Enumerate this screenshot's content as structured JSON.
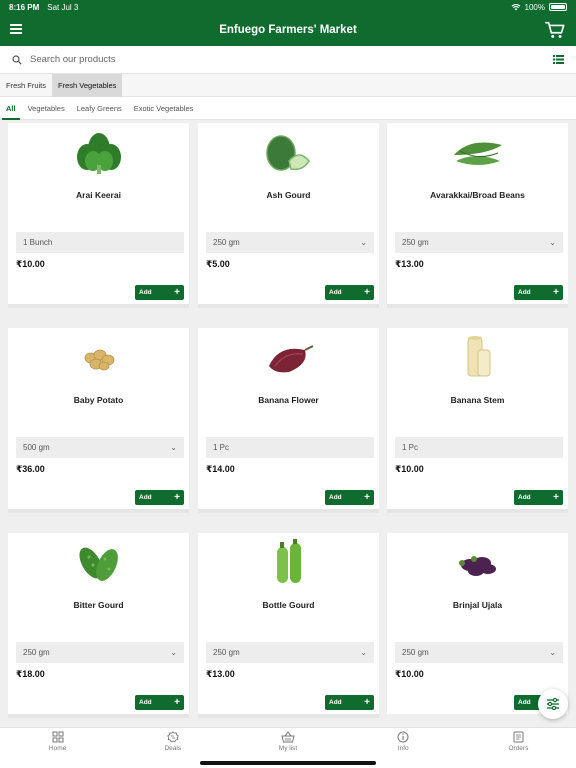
{
  "status_bar": {
    "time": "8:16 PM",
    "date": "Sat Jul 3",
    "battery": "100%"
  },
  "header": {
    "title": "Enfuego Farmers' Market"
  },
  "search": {
    "placeholder": "Search our products"
  },
  "category_tabs": [
    {
      "label": "Fresh Fruits",
      "active": false
    },
    {
      "label": "Fresh Vegetables",
      "active": true
    }
  ],
  "sub_tabs": [
    {
      "label": "All",
      "active": true
    },
    {
      "label": "Vegetables",
      "active": false
    },
    {
      "label": "Leafy Greens",
      "active": false
    },
    {
      "label": "Exotic Vegetables",
      "active": false
    }
  ],
  "products": [
    {
      "name": "Arai Keerai",
      "quantity": "1 Bunch",
      "has_dropdown": false,
      "price": "₹10.00",
      "add_label": "Add",
      "icon": "spinach-icon"
    },
    {
      "name": "Ash Gourd",
      "quantity": "250 gm",
      "has_dropdown": true,
      "price": "₹5.00",
      "add_label": "Add",
      "icon": "ash-gourd-icon"
    },
    {
      "name": "Avarakkai/Broad Beans",
      "quantity": "250 gm",
      "has_dropdown": true,
      "price": "₹13.00",
      "add_label": "Add",
      "icon": "broad-beans-icon"
    },
    {
      "name": "Baby Potato",
      "quantity": "500 gm",
      "has_dropdown": true,
      "price": "₹36.00",
      "add_label": "Add",
      "icon": "potato-icon"
    },
    {
      "name": "Banana Flower",
      "quantity": "1 Pc",
      "has_dropdown": false,
      "price": "₹14.00",
      "add_label": "Add",
      "icon": "banana-flower-icon"
    },
    {
      "name": "Banana Stem",
      "quantity": "1 Pc",
      "has_dropdown": false,
      "price": "₹10.00",
      "add_label": "Add",
      "icon": "banana-stem-icon"
    },
    {
      "name": "Bitter Gourd",
      "quantity": "250 gm",
      "has_dropdown": true,
      "price": "₹18.00",
      "add_label": "Add",
      "icon": "bitter-gourd-icon"
    },
    {
      "name": "Bottle Gourd",
      "quantity": "250 gm",
      "has_dropdown": true,
      "price": "₹13.00",
      "add_label": "Add",
      "icon": "bottle-gourd-icon"
    },
    {
      "name": "Brinjal Ujala",
      "quantity": "250 gm",
      "has_dropdown": true,
      "price": "₹10.00",
      "add_label": "Add",
      "icon": "brinjal-icon"
    }
  ],
  "bottom_nav": [
    {
      "label": "Home",
      "icon": "home-grid-icon"
    },
    {
      "label": "Deals",
      "icon": "deals-badge-icon"
    },
    {
      "label": "My list",
      "icon": "shopping-basket-icon"
    },
    {
      "label": "Info",
      "icon": "info-icon"
    },
    {
      "label": "Orders",
      "icon": "orders-document-icon"
    }
  ],
  "colors": {
    "brand": "#0f6b2e",
    "background": "#efefef",
    "card": "#ffffff",
    "input": "#ededed"
  }
}
